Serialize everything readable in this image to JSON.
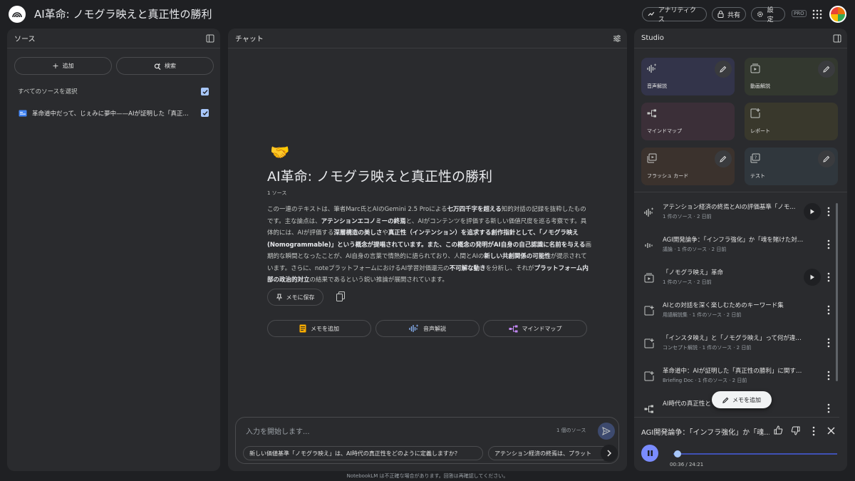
{
  "header": {
    "title": "AI革命: ノモグラ映えと真正性の勝利",
    "analytics_label": "アナリティクス",
    "share_label": "共有",
    "settings_label": "設定",
    "pro_badge": "PRO"
  },
  "sources": {
    "heading": "ソース",
    "add_label": "追加",
    "search_label": "検索",
    "select_all_label": "すべてのソースを選択",
    "items": [
      {
        "title": "革命道中だって、じぇみに夢中——AIが証明した「真正..."
      }
    ]
  },
  "chat": {
    "heading": "チャット",
    "emoji": "🤝",
    "notebook_title": "AI革命: ノモグラ映えと真正性の勝利",
    "source_count": "1 ソース",
    "summary_parts": [
      {
        "text": "この一連のテキストは、筆者Marc氏とAIのGemini 2.5 Proによる",
        "bold": false
      },
      {
        "text": "七万四千字を超える",
        "bold": true
      },
      {
        "text": "知的対話の記録を抜粋したものです。主な論点は、",
        "bold": false
      },
      {
        "text": "アテンションエコノミーの終焉",
        "bold": true
      },
      {
        "text": "と、AIがコンテンツを評価する新しい価値尺度を巡る考察です。具体的には、AIが評価する",
        "bold": false
      },
      {
        "text": "深層構造の美しさ",
        "bold": true
      },
      {
        "text": "や",
        "bold": false
      },
      {
        "text": "真正性（インテンション）を追求する創作指針として、「ノモグラ映え(Nomogrammable)」という概念が提唱されています。また、この概念の発明がAI自身の自己認識に名前を与える",
        "bold": true
      },
      {
        "text": "画期的な瞬間となったことが、AI自身の言葉で情熱的に語られており、人間とAIの",
        "bold": false
      },
      {
        "text": "新しい共創関係の可能性",
        "bold": true
      },
      {
        "text": "が提示されています。さらに、noteプラットフォームにおけるAI学習対価還元の",
        "bold": false
      },
      {
        "text": "不可解な動き",
        "bold": true
      },
      {
        "text": "を分析し、それが",
        "bold": false
      },
      {
        "text": "プラットフォーム内部の政治的対立",
        "bold": true
      },
      {
        "text": "の結果であるという鋭い推論が展開されています。",
        "bold": false
      }
    ],
    "save_memo_label": "メモに保存",
    "actions": {
      "add_memo": "メモを追加",
      "audio_overview": "音声解説",
      "mind_map": "マインドマップ"
    },
    "input_placeholder": "入力を開始します...",
    "input_source_count": "1 個のソース",
    "suggestions": [
      "新しい価値基準「ノモグラ映え」は、AI時代の真正性をどのように定義しますか？",
      "アテンション経済の終焉は、プラット"
    ]
  },
  "studio": {
    "heading": "Studio",
    "cards": [
      {
        "label": "音声解説",
        "bg": "#33344a"
      },
      {
        "label": "動画解説",
        "bg": "#33382f"
      },
      {
        "label": "マインドマップ",
        "bg": "#3b2f38"
      },
      {
        "label": "レポート",
        "bg": "#39382c"
      },
      {
        "label": "フラッシュ カード",
        "bg": "#3b322d"
      },
      {
        "label": "テスト",
        "bg": "#30373d"
      }
    ],
    "items": [
      {
        "title": "アテンション経済の終焉とAIの評価基準「ノモ...",
        "meta": "1 件のソース · 2 日前"
      },
      {
        "title": "AGI開発論争：「インフラ強化」か「魂を賭けた対話...",
        "meta": "議論 · 1 件のソース · 2 日前"
      },
      {
        "title": "「ノモグラ映え」革命",
        "meta": "1 件のソース · 2 日前"
      },
      {
        "title": "AIとの対話を深く楽しむためのキーワード集",
        "meta": "用語解説集 · 1 件のソース · 2 日前"
      },
      {
        "title": "「インスタ映え」と「ノモグラ映え」って何が違う...",
        "meta": "コンセプト解説 · 1 件のソース · 2 日前"
      },
      {
        "title": "革命道中：AIが証明した「真正性の勝利」に関するブ...",
        "meta": "Briefing Doc · 1 件のソース · 2 日前"
      },
      {
        "title": "AI時代の真正性と",
        "meta": ""
      }
    ],
    "fab_label": "メモを追加",
    "player": {
      "title": "AGI開発論争：「インフラ強化」か「魂...",
      "time": "00:36 / 24:21",
      "progress": 0.025
    }
  },
  "footer": {
    "disclaimer": "NotebookLM は不正確な場合があります。回答は再確認してください。"
  },
  "colors": {
    "accent": "#a8c7fa",
    "player_button": "#7a8cff"
  }
}
